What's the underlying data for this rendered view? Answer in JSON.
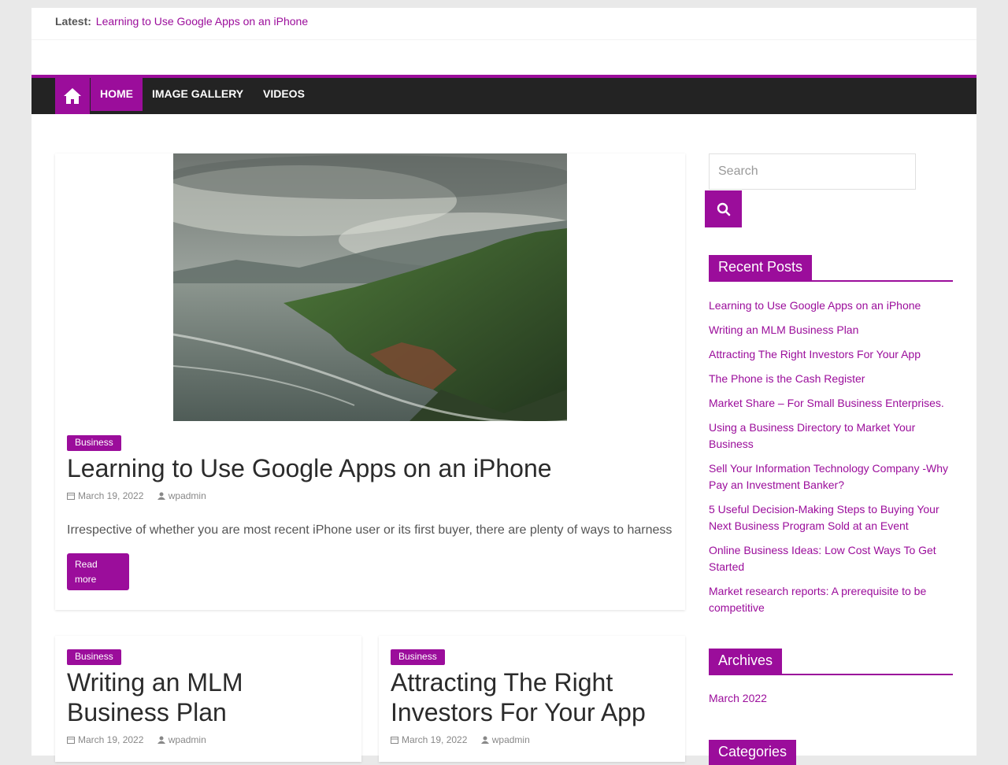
{
  "topbar": {
    "latest_label": "Latest:",
    "latest_link": "Learning to Use Google Apps on an iPhone"
  },
  "nav": {
    "home_icon": "home-icon",
    "items": [
      {
        "label": "HOME",
        "active": true
      },
      {
        "label": "IMAGE GALLERY",
        "active": false
      },
      {
        "label": "VIDEOS",
        "active": false
      }
    ]
  },
  "featured": {
    "category": "Business",
    "title": "Learning to Use Google Apps on an iPhone",
    "date": "March 19, 2022",
    "author": "wpadmin",
    "excerpt": "Irrespective of whether you are most recent iPhone user or its first buyer, there are plenty of ways to harness",
    "read_more_line1": "Read",
    "read_more_line2": "more"
  },
  "posts": [
    {
      "category": "Business",
      "title_line1": "Writing an MLM",
      "title_line2": "Business Plan",
      "date": "March 19, 2022",
      "author": "wpadmin"
    },
    {
      "category": "Business",
      "title_line1": "Attracting The Right",
      "title_line2": "Investors For Your App",
      "date": "March 19, 2022",
      "author": "wpadmin"
    }
  ],
  "sidebar": {
    "search_placeholder": "Search",
    "recent_heading": "Recent Posts",
    "recent_posts": [
      "Learning to Use Google Apps on an iPhone",
      "Writing an MLM Business Plan",
      "Attracting The Right Investors For Your App",
      "The Phone is the Cash Register",
      "Market Share – For Small Business Enterprises.",
      "Using a Business Directory to Market Your Business",
      "Sell Your Information Technology Company -Why Pay an Investment Banker?",
      "5 Useful Decision-Making Steps to Buying Your Next Business Program Sold at an Event",
      "Online Business Ideas: Low Cost Ways To Get Started",
      "Market research reports: A prerequisite to be competitive"
    ],
    "archives_heading": "Archives",
    "archives": [
      "March 2022"
    ],
    "categories_heading": "Categories"
  },
  "colors": {
    "accent": "#9b0d9b",
    "nav_bg": "#232323"
  }
}
